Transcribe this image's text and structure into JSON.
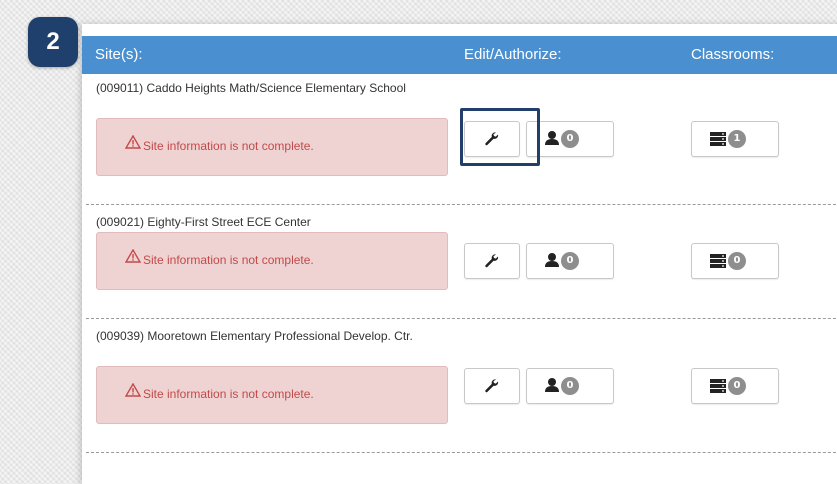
{
  "step_number": "2",
  "header": {
    "sites": "Site(s):",
    "edit_authorize": "Edit/Authorize:",
    "classrooms": "Classrooms:"
  },
  "rows": [
    {
      "site_name": "(009011) Caddo Heights Math/Science Elementary School",
      "alert": "Site information is not complete.",
      "user_count": "0",
      "classroom_count": "1"
    },
    {
      "site_name": "(009021) Eighty-First Street ECE Center",
      "alert": "Site information is not complete.",
      "user_count": "0",
      "classroom_count": "0"
    },
    {
      "site_name": "(009039) Mooretown Elementary Professional Develop. Ctr.",
      "alert": "Site information is not complete.",
      "user_count": "0",
      "classroom_count": "0"
    }
  ],
  "icons": {
    "edit": "wrench-icon",
    "authorize": "user-icon",
    "classrooms": "server-stack-icon",
    "alert": "warning-triangle-icon"
  },
  "colors": {
    "header_bg": "#4a90d0",
    "alert_bg": "#efd3d3",
    "alert_text": "#c24a4a",
    "step_badge": "#1f3f6d",
    "highlight_border": "#223f6b",
    "count_badge": "#8e8e8e"
  }
}
